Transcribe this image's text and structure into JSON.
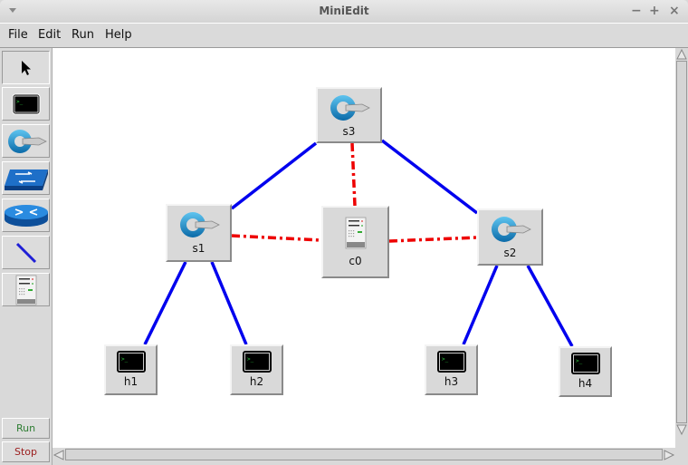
{
  "window": {
    "title": "MiniEdit",
    "controls": {
      "minimize": "−",
      "maximize": "+",
      "close": "×"
    }
  },
  "menubar": {
    "items": [
      {
        "label": "File"
      },
      {
        "label": "Edit"
      },
      {
        "label": "Run"
      },
      {
        "label": "Help"
      }
    ]
  },
  "toolbar": {
    "tools": [
      {
        "name": "select",
        "icon": "pointer-arrow-icon"
      },
      {
        "name": "host",
        "icon": "terminal-icon"
      },
      {
        "name": "switch",
        "icon": "switch-icon"
      },
      {
        "name": "legacy-switch",
        "icon": "legacy-switch-icon"
      },
      {
        "name": "router",
        "icon": "router-icon"
      },
      {
        "name": "link",
        "icon": "link-icon"
      },
      {
        "name": "controller",
        "icon": "controller-server-icon"
      }
    ],
    "run_label": "Run",
    "stop_label": "Stop",
    "run_color": "#2e7d32",
    "stop_color": "#9b1c1c"
  },
  "topology": {
    "nodes": [
      {
        "id": "s3",
        "label": "s3",
        "type": "switch"
      },
      {
        "id": "s1",
        "label": "s1",
        "type": "switch"
      },
      {
        "id": "s2",
        "label": "s2",
        "type": "switch"
      },
      {
        "id": "c0",
        "label": "c0",
        "type": "controller"
      },
      {
        "id": "h1",
        "label": "h1",
        "type": "host"
      },
      {
        "id": "h2",
        "label": "h2",
        "type": "host"
      },
      {
        "id": "h3",
        "label": "h3",
        "type": "host"
      },
      {
        "id": "h4",
        "label": "h4",
        "type": "host"
      }
    ],
    "links": [
      {
        "from": "s3",
        "to": "s1",
        "kind": "data"
      },
      {
        "from": "s3",
        "to": "s2",
        "kind": "data"
      },
      {
        "from": "s1",
        "to": "h1",
        "kind": "data"
      },
      {
        "from": "s1",
        "to": "h2",
        "kind": "data"
      },
      {
        "from": "s2",
        "to": "h3",
        "kind": "data"
      },
      {
        "from": "s2",
        "to": "h4",
        "kind": "data"
      },
      {
        "from": "c0",
        "to": "s3",
        "kind": "control"
      },
      {
        "from": "c0",
        "to": "s1",
        "kind": "control"
      },
      {
        "from": "c0",
        "to": "s2",
        "kind": "control"
      }
    ],
    "colors": {
      "data_link": "#0000ee",
      "control_link": "#ee0000"
    }
  }
}
